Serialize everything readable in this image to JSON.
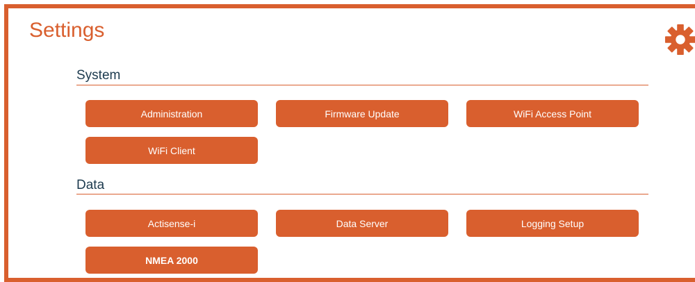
{
  "header": {
    "title": "Settings",
    "settings_icon": "gear-icon",
    "accent_color": "#d95f2e"
  },
  "sections": [
    {
      "heading": "System",
      "buttons": [
        "Administration",
        "Firmware Update",
        "WiFi Access Point",
        "WiFi Client"
      ]
    },
    {
      "heading": "Data",
      "buttons": [
        "Actisense-i",
        "Data Server",
        "Logging Setup",
        "NMEA 2000"
      ]
    }
  ]
}
